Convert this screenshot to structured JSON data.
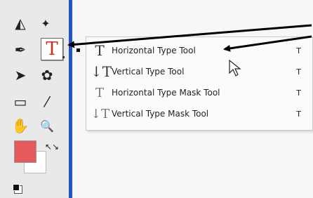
{
  "toolbox": {
    "tools": [
      {
        "name": "blur-tool",
        "glyph": "◭"
      },
      {
        "name": "dodge-tool",
        "glyph": "✒"
      },
      {
        "name": "pen-tool",
        "glyph": "✎"
      },
      {
        "name": "path-selection-tool",
        "glyph": "➤"
      },
      {
        "name": "custom-shape-tool",
        "glyph": "✿"
      },
      {
        "name": "notes-tool",
        "glyph": "▭"
      },
      {
        "name": "eyedropper-tool",
        "glyph": "⁄"
      },
      {
        "name": "hand-tool",
        "glyph": "✋"
      },
      {
        "name": "zoom-tool",
        "glyph": "🔍"
      }
    ],
    "active_tool_glyph": "T",
    "swap_glyph": "↖↘",
    "foreground_color": "#e55b5b",
    "background_color": "#ffffff"
  },
  "flyout": {
    "items": [
      {
        "label": "Horizontal Type Tool",
        "icon": "T",
        "shortcut": "T",
        "selected": true
      },
      {
        "label": "Vertical Type Tool",
        "icon": "↓T",
        "shortcut": "T",
        "selected": false
      },
      {
        "label": "Horizontal Type Mask Tool",
        "icon": "T",
        "shortcut": "T",
        "selected": false
      },
      {
        "label": "Vertical Type Mask Tool",
        "icon": "↓T",
        "shortcut": "T",
        "selected": false
      }
    ]
  },
  "colors": {
    "divider": "#1e56c8",
    "type_icon": "#d62a1f"
  }
}
